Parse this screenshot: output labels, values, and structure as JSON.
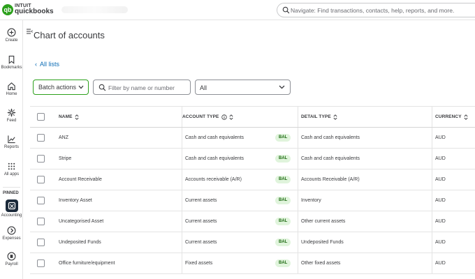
{
  "topbar": {
    "brand_intuit": "INTUIT",
    "brand_product": "quickbooks",
    "brand_mark": "qb",
    "search_placeholder": "Navigate: Find transactions, contacts, help, reports, and more."
  },
  "leftnav": {
    "items": [
      {
        "label": "Create",
        "icon": "plus-circle-icon"
      },
      {
        "label": "Bookmarks",
        "icon": "bookmark-icon"
      },
      {
        "label": "Home",
        "icon": "home-icon"
      },
      {
        "label": "Feed",
        "icon": "sparkle-icon"
      },
      {
        "label": "Reports",
        "icon": "chart-line-icon"
      },
      {
        "label": "All apps",
        "icon": "grid-icon"
      }
    ],
    "pinned_label": "PINNED",
    "pinned": [
      {
        "label": "Accounting",
        "icon": "accounting-icon"
      },
      {
        "label": "Expenses",
        "icon": "expenses-icon"
      },
      {
        "label": "Payroll",
        "icon": "payroll-icon"
      }
    ]
  },
  "page": {
    "title": "Chart of accounts",
    "back_link": "All lists",
    "batch_actions": "Batch actions",
    "filter_placeholder": "Filter by name or number",
    "type_filter_value": "All"
  },
  "table": {
    "columns": {
      "name": "NAME",
      "account_type": "ACCOUNT TYPE",
      "detail_type": "DETAIL TYPE",
      "currency": "CURRENCY"
    },
    "badge": "BAL",
    "rows": [
      {
        "name": "ANZ",
        "account_type": "Cash and cash equivalents",
        "detail_type": "Cash and cash equivalents",
        "currency": "AUD"
      },
      {
        "name": "Stripe",
        "account_type": "Cash and cash equivalents",
        "detail_type": "Cash and cash equivalents",
        "currency": "AUD"
      },
      {
        "name": "Account Receivable",
        "account_type": "Accounts receivable (A/R)",
        "detail_type": "Accounts Receivable (A/R)",
        "currency": "AUD"
      },
      {
        "name": "Inventory Asset",
        "account_type": "Current assets",
        "detail_type": "Inventory",
        "currency": "AUD"
      },
      {
        "name": "Uncategorised Asset",
        "account_type": "Current assets",
        "detail_type": "Other current assets",
        "currency": "AUD"
      },
      {
        "name": "Undeposited Funds",
        "account_type": "Current assets",
        "detail_type": "Undeposited Funds",
        "currency": "AUD"
      },
      {
        "name": "Office furniture/equipment",
        "account_type": "Fixed assets",
        "detail_type": "Other fixed assets",
        "currency": "AUD"
      }
    ]
  },
  "colors": {
    "brand_green": "#2ca01c",
    "link_blue": "#0d6db5",
    "badge_bg": "#e0f4dc",
    "text": "#393a3d"
  }
}
